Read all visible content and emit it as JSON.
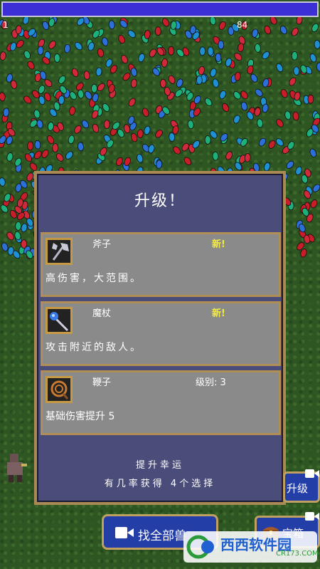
{
  "hud": {
    "xp_fill": 1.0,
    "timer": "1",
    "kills": "84"
  },
  "levelup": {
    "title": "升级！",
    "choices": [
      {
        "name": "斧子",
        "tag": "新!",
        "level": "",
        "description": "高伤害，大范围。",
        "icon": "axe-icon"
      },
      {
        "name": "魔杖",
        "tag": "新!",
        "level": "",
        "description": "攻击附近的敌人。",
        "icon": "magic-wand-icon"
      },
      {
        "name": "鞭子",
        "tag": "",
        "level": "级别: 3",
        "description": "基础伤害提升 5",
        "icon": "whip-icon"
      }
    ],
    "luck_line": "提升幸运",
    "luck_line2": "有几率获得 4个选择"
  },
  "buttons": {
    "find_all": "找全部兽",
    "upgrade": "升级",
    "chest": "宝箱"
  },
  "watermark": {
    "brand": "西西软件园",
    "url": "CR173.COM"
  },
  "colors": {
    "panel_bg": "#4a4c7a",
    "card_bg": "#8a8a8a",
    "gold_border": "#b08e55",
    "new_tag": "#f4ea3a",
    "xp_bar": "#3d2fd6",
    "button_blue": "#243ea8"
  }
}
